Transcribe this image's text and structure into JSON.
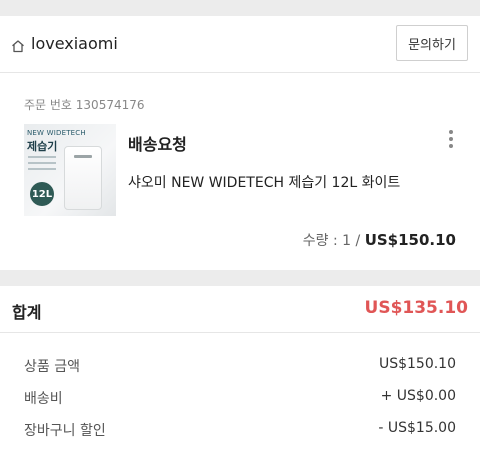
{
  "store": {
    "name": "lovexiaomi",
    "inquiry_label": "문의하기",
    "icon": "home-icon"
  },
  "order": {
    "order_number": "주문 번호 130574176",
    "status": "배송요청",
    "product_name": "샤오미 NEW WIDETECH 제습기 12L 화이트",
    "thumbnail": {
      "brand": "NEW WIDETECH",
      "title": "제습기",
      "badge": "12L"
    },
    "quantity_text": "수량 : 1 / ",
    "price": "US$150.10"
  },
  "summary": {
    "total_label": "합계",
    "total_value": "US$135.10",
    "lines": [
      {
        "label": "상품 금액",
        "value": "US$150.10"
      },
      {
        "label": "배송비",
        "value": "+ US$0.00"
      },
      {
        "label": "장바구니 할인",
        "value": "- US$15.00"
      }
    ]
  },
  "colors": {
    "accent_total": "#e05656",
    "background": "#ececec"
  }
}
